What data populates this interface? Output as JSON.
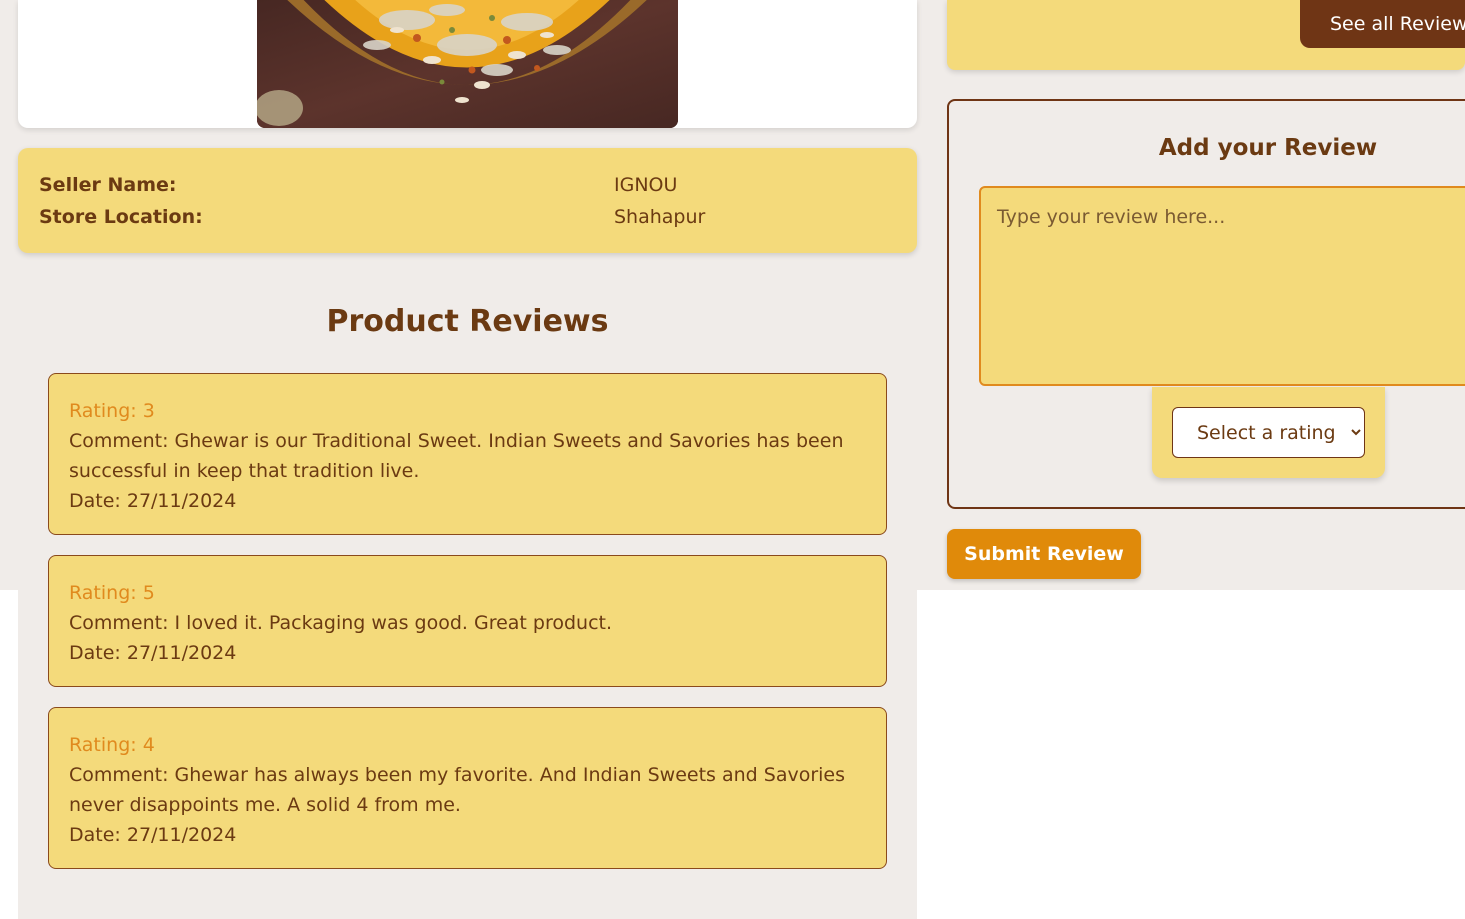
{
  "product": {
    "image_alt": "Ghewar"
  },
  "seller": {
    "name_label": "Seller Name:",
    "name_value": "IGNOU",
    "location_label": "Store Location:",
    "location_value": "Shahapur"
  },
  "reviews": {
    "title": "Product Reviews",
    "items": [
      {
        "rating": "Rating: 3",
        "comment": "Comment: Ghewar is our Traditional Sweet. Indian Sweets and Savories has been successful in keep that tradition live.",
        "date": "Date: 27/11/2024"
      },
      {
        "rating": "Rating: 5",
        "comment": "Comment: I loved it. Packaging was good. Great product.",
        "date": "Date: 27/11/2024"
      },
      {
        "rating": "Rating: 4",
        "comment": "Comment: Ghewar has always been my favorite. And Indian Sweets and Savories never disappoints me. A solid 4 from me.",
        "date": "Date: 27/11/2024"
      }
    ]
  },
  "sidebar": {
    "see_all_label": "See all Reviews",
    "add_review_title": "Add your Review",
    "textarea_placeholder": "Type your review here...",
    "rating_select_label": "Select a rating",
    "submit_label": "Submit Review"
  },
  "colors": {
    "panel": "#f4da7b",
    "brown": "#6f3515",
    "accent": "#e08a0a",
    "background": "#f0ece9"
  }
}
